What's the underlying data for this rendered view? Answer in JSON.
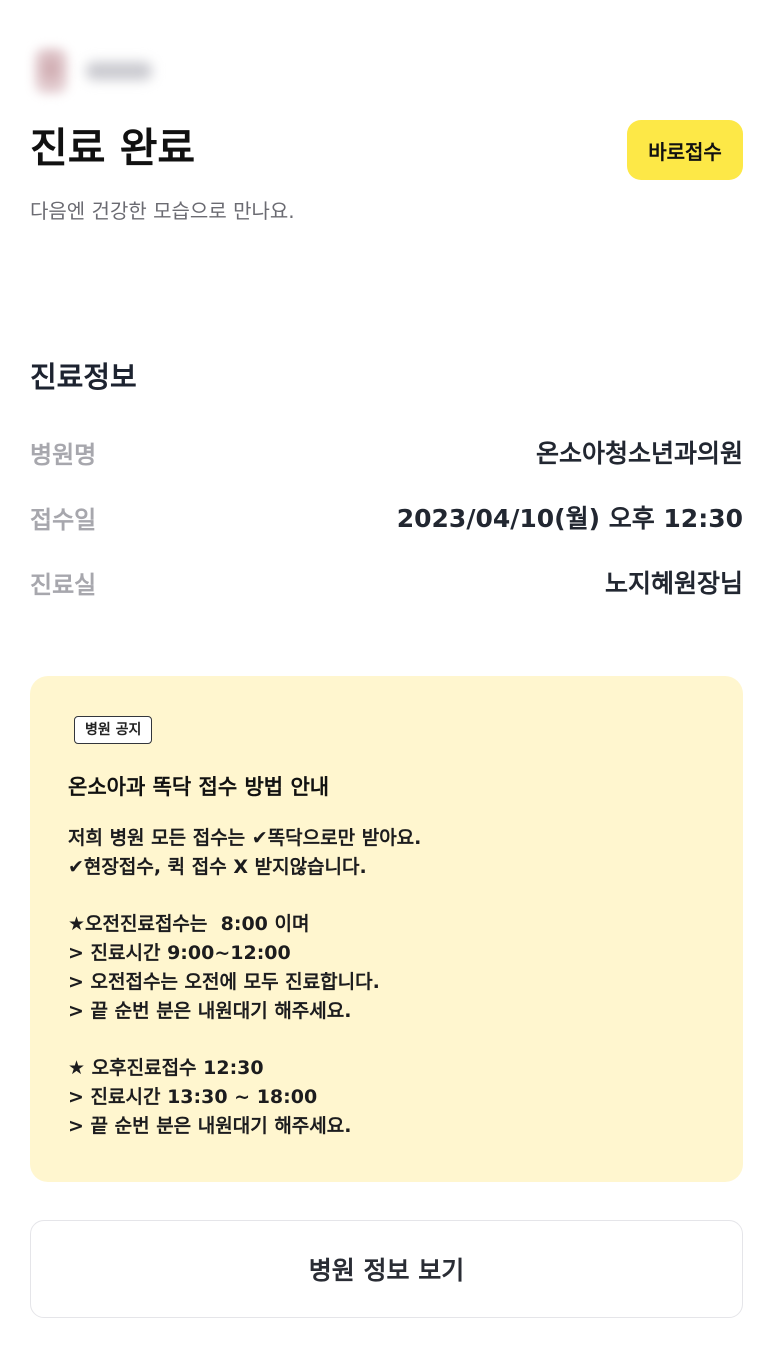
{
  "header": {
    "title": "진료 완료",
    "subtitle": "다음엔 건강한 모습으로 만나요.",
    "quick_button_label": "바로접수"
  },
  "info": {
    "section_title": "진료정보",
    "rows": [
      {
        "label": "병원명",
        "value": "온소아청소년과의원"
      },
      {
        "label": "접수일",
        "value": "2023/04/10(월) 오후 12:30"
      },
      {
        "label": "진료실",
        "value": "노지혜원장님"
      }
    ]
  },
  "notice": {
    "tag": "병원 공지",
    "title": "온소아과 똑닥 접수 방법 안내",
    "lines": [
      "저희 병원 모든 접수는 ✔똑닥으로만 받아요.",
      "✔현장접수, 퀵 접수 X 받지않습니다.",
      "",
      "★오전진료접수는  8:00 이며",
      "> 진료시간 9:00~12:00",
      "> 오전접수는 오전에 모두 진료합니다.",
      "> 끝 순번 분은 내원대기 해주세요.",
      "",
      "★ 오후진료접수 12:30",
      "> 진료시간 13:30 ~ 18:00",
      "> 끝 순번 분은 내원대기 해주세요."
    ]
  },
  "footer": {
    "hospital_info_button": "병원 정보 보기"
  },
  "colors": {
    "accent_yellow": "#fde847",
    "notice_background": "#fff6cf"
  }
}
